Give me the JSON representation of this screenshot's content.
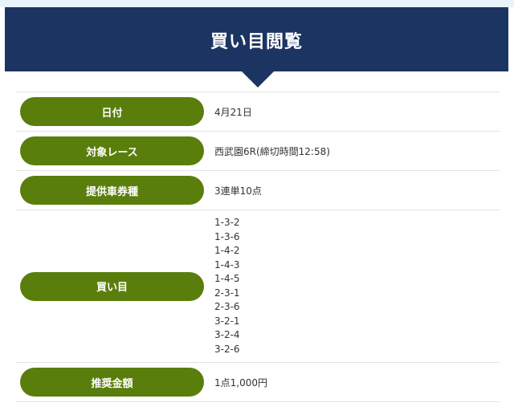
{
  "header": {
    "title": "買い目閲覧"
  },
  "rows": [
    {
      "label": "日付",
      "value": "4月21日"
    },
    {
      "label": "対象レース",
      "value": "西武園6R(締切時間12:58)"
    },
    {
      "label": "提供車券種",
      "value": "3連単10点"
    },
    {
      "label": "買い目",
      "combos": [
        "1-3-2",
        "1-3-6",
        "1-4-2",
        "1-4-3",
        "1-4-5",
        "2-3-1",
        "2-3-6",
        "3-2-1",
        "3-2-4",
        "3-2-6"
      ]
    },
    {
      "label": "推奨金額",
      "value": "1点1,000円"
    }
  ],
  "colors": {
    "banner": "#1c3461",
    "pill": "#5a7e0c",
    "top_strip": "#e9f3fb"
  }
}
